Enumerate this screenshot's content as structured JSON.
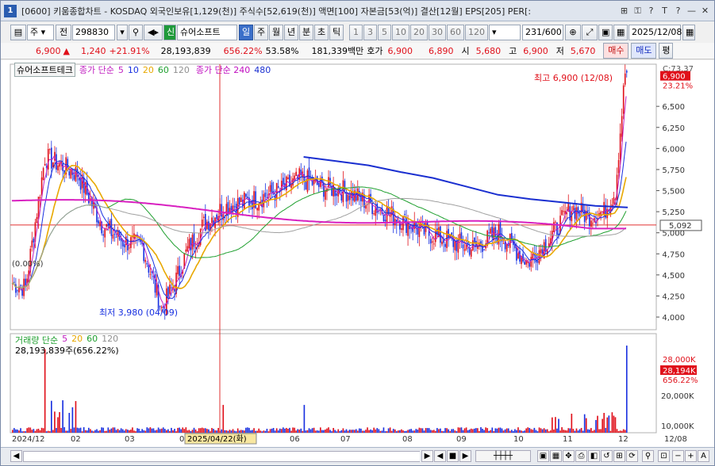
{
  "titlebar": {
    "num": "1",
    "text": "[0600] 키움종합차트 - KOSDAQ 외국인보유[1,129(천)] 주식수[52,619(천)] 액면[100] 자본금[53(억)] 결산[12월] EPS[205] PER[:",
    "icons": [
      "link-icon",
      "lock-icon",
      "help-icon",
      "text-icon",
      "pin-icon",
      "minimize-icon",
      "close-icon"
    ]
  },
  "toolbar": {
    "market": "주",
    "prev": "전",
    "code": "298830",
    "credit_badge": "신",
    "name": "슈어소프트",
    "period_buttons": [
      "일",
      "주",
      "월",
      "년",
      "분",
      "초",
      "틱"
    ],
    "num_buttons": [
      "1",
      "3",
      "5",
      "10",
      "20",
      "30",
      "60",
      "120"
    ],
    "count": "231",
    "count_max": "/600",
    "date": "2025/12/08"
  },
  "quote": {
    "price": "6,900",
    "change": "1,240",
    "change_pct": "+21.91%",
    "volume": "28,193,839",
    "vol_ratio": "656.22%",
    "turnover": "53.58%",
    "amount": "181,339백만",
    "ask_label": "호가",
    "ask": "6,900",
    "bid": "6,890",
    "open_label": "시",
    "open": "5,680",
    "high_label": "고",
    "high": "6,900",
    "low_label": "저",
    "low": "5,670",
    "buy": "매수",
    "sell": "매도",
    "flat": "평"
  },
  "legend": {
    "name": "슈어소프트테크",
    "ma_label": "종가 단순",
    "ma_periods": [
      "5",
      "10",
      "20",
      "60",
      "120"
    ],
    "ma240_label": "종가 단순 240",
    "ma240_value": "480",
    "colors": {
      "5": "#c020c0",
      "10": "#1830e0",
      "20": "#e8a800",
      "60": "#20a030",
      "120": "#a0a0a0",
      "240": "#d820c0",
      "480": "#1a2fd0"
    }
  },
  "price_axis": {
    "ticks": [
      "6,500",
      "6,250",
      "6,000",
      "5,750",
      "5,500",
      "5,250",
      "5,000",
      "4,750",
      "4,500",
      "4,250",
      "4,000"
    ],
    "top_label": "C:73.37",
    "current": "6,900",
    "current_pct": "23.21%",
    "ref": "5,092"
  },
  "annotations": {
    "high": "최고 6,900 (12/08)",
    "low": "최저 3,980 (04/09)",
    "pct": "(0.00%)"
  },
  "volume_pane": {
    "label": "거래량 단순",
    "ma": [
      "5",
      "20",
      "60",
      "120"
    ],
    "value_text": "28,193,839주(656.22%)",
    "ticks": [
      "20,000K",
      "10,000K"
    ],
    "cur_top": "28,000K",
    "cur": "28,194K",
    "cur_pct": "656.22%"
  },
  "x_axis": {
    "labels": [
      "2024/12",
      "02",
      "03",
      "04",
      "06",
      "07",
      "08",
      "09",
      "10",
      "11",
      "12",
      "12/08"
    ],
    "crosshair_date": "2025/04/22(화)"
  },
  "chart_data": {
    "type": "candlestick",
    "ylim": [
      3850,
      7000
    ],
    "markers": {
      "high": {
        "date": "12/08",
        "value": 6900
      },
      "low": {
        "date": "04/09",
        "value": 3980
      }
    },
    "ma240": 5050,
    "ma480": [
      5900,
      5850,
      5800,
      5720,
      5650,
      5550,
      5450,
      5400,
      5360,
      5320,
      5300
    ]
  }
}
